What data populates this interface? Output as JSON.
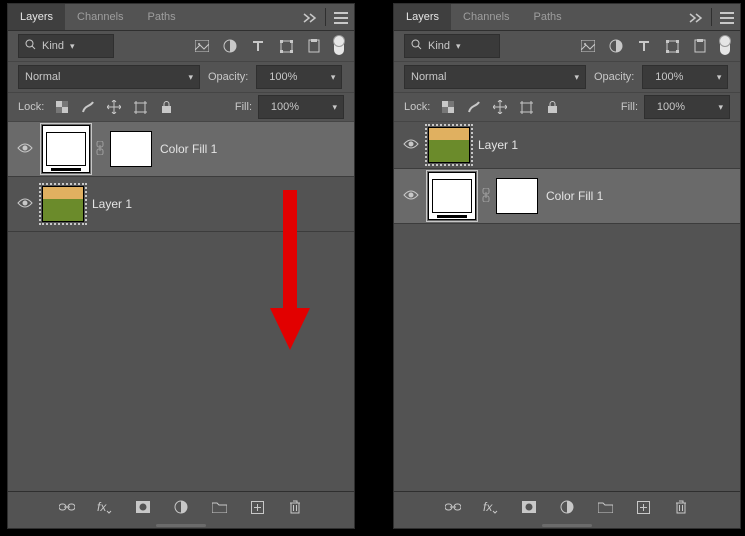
{
  "tabs": {
    "layers": "Layers",
    "channels": "Channels",
    "paths": "Paths"
  },
  "filter": {
    "kind_label": "Kind"
  },
  "blend": {
    "mode": "Normal",
    "opacity_label": "Opacity:",
    "opacity_value": "100%"
  },
  "lock": {
    "label": "Lock:",
    "fill_label": "Fill:",
    "fill_value": "100%"
  },
  "left_panel": {
    "layers": [
      {
        "name": "Color Fill 1",
        "type": "fill",
        "selected": true
      },
      {
        "name": "Layer 1",
        "type": "image",
        "selected": false
      }
    ]
  },
  "right_panel": {
    "layers": [
      {
        "name": "Layer 1",
        "type": "image",
        "selected": false
      },
      {
        "name": "Color Fill 1",
        "type": "fill",
        "selected": true
      }
    ]
  },
  "annotation": {
    "type": "arrow",
    "color": "#e20000",
    "meaning": "drag Color Fill 1 layer downward"
  }
}
